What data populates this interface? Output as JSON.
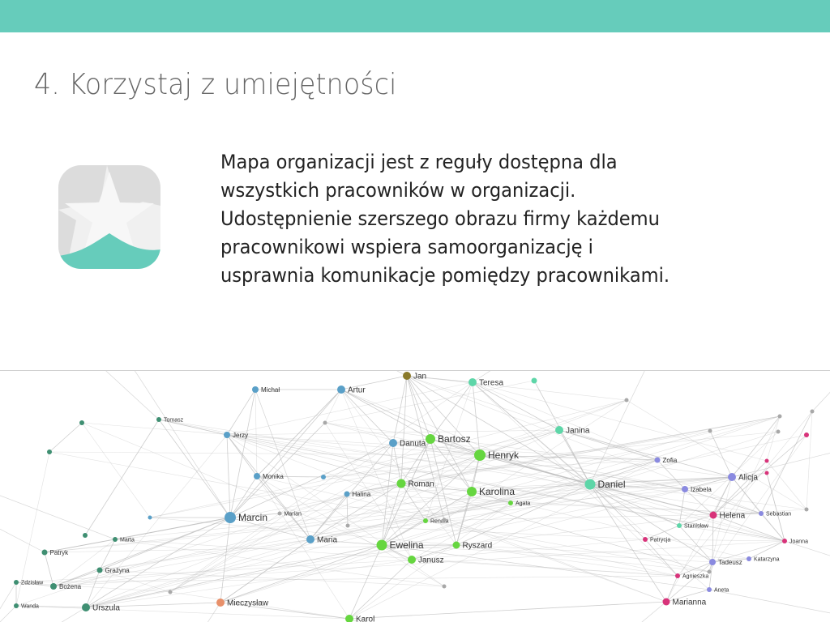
{
  "header": {
    "accent_color": "#66ccbb"
  },
  "title": "4. Korzystaj z umiejętności",
  "body_text": "Mapa organizacji jest z reguły dostępna dla\nwszystkich pracowników w organizacji.\nUdostępnienie szerszego obrazu firmy każdemu\npracownikowi wspiera samoorganizację i\nusprawnia komunikacje pomiędzy pracownikami.",
  "logo": {
    "icon": "star-icon",
    "colors": {
      "tile_light": "#f0f0f0",
      "tile_dark": "#dcdcdc",
      "accent": "#66ccbb"
    }
  },
  "network": {
    "edge_color": "#bdbdbd",
    "nodes": [
      {
        "id": "jan",
        "label": "Jan",
        "color": "#8a7a2a"
      },
      {
        "id": "teresa",
        "label": "Teresa",
        "color": "#5ed6a8"
      },
      {
        "id": "michal",
        "label": "Michał",
        "color": "#5aa0c8"
      },
      {
        "id": "artur",
        "label": "Artur",
        "color": "#5aa0c8"
      },
      {
        "id": "tomasz",
        "label": "Tomasz",
        "color": "#3f8f72"
      },
      {
        "id": "jerzy",
        "label": "Jerzy",
        "color": "#5aa0c8"
      },
      {
        "id": "danuta",
        "label": "Danuta",
        "color": "#5aa0c8"
      },
      {
        "id": "bartosz",
        "label": "Bartosz",
        "color": "#66d640"
      },
      {
        "id": "henryk",
        "label": "Henryk",
        "color": "#66d640"
      },
      {
        "id": "janina",
        "label": "Janina",
        "color": "#5ed6a8"
      },
      {
        "id": "zofia",
        "label": "Zofia",
        "color": "#8a8ae0"
      },
      {
        "id": "monika",
        "label": "Monika",
        "color": "#5aa0c8"
      },
      {
        "id": "roman",
        "label": "Roman",
        "color": "#66d640"
      },
      {
        "id": "karolina",
        "label": "Karolina",
        "color": "#66d640"
      },
      {
        "id": "daniel",
        "label": "Daniel",
        "color": "#5ed6a8"
      },
      {
        "id": "alicja",
        "label": "Alicja",
        "color": "#8a8ae0"
      },
      {
        "id": "izabela",
        "label": "Izabela",
        "color": "#8a8ae0"
      },
      {
        "id": "halina",
        "label": "Halina",
        "color": "#5aa0c8"
      },
      {
        "id": "agata",
        "label": "Agata",
        "color": "#66d640"
      },
      {
        "id": "marcin",
        "label": "Marcin",
        "color": "#5aa0c8"
      },
      {
        "id": "marian",
        "label": "Marian",
        "color": "#a8a8a8"
      },
      {
        "id": "renata",
        "label": "Renata",
        "color": "#66d640"
      },
      {
        "id": "helena",
        "label": "Helena",
        "color": "#d8337a"
      },
      {
        "id": "sebastian",
        "label": "Sebastian",
        "color": "#8a8ae0"
      },
      {
        "id": "stanislaw",
        "label": "Stanisław",
        "color": "#5ed6a8"
      },
      {
        "id": "maria",
        "label": "Maria",
        "color": "#5aa0c8"
      },
      {
        "id": "ewelina",
        "label": "Ewelina",
        "color": "#66d640"
      },
      {
        "id": "ryszard",
        "label": "Ryszard",
        "color": "#66d640"
      },
      {
        "id": "patrycja",
        "label": "Patrycja",
        "color": "#d8337a"
      },
      {
        "id": "joanna",
        "label": "Joanna",
        "color": "#d8337a"
      },
      {
        "id": "marta",
        "label": "Marta",
        "color": "#3f8f72"
      },
      {
        "id": "patryk",
        "label": "Patryk",
        "color": "#3f8f72"
      },
      {
        "id": "janusz",
        "label": "Janusz",
        "color": "#66d640"
      },
      {
        "id": "tadeusz",
        "label": "Tadeusz",
        "color": "#8a8ae0"
      },
      {
        "id": "katarzyna",
        "label": "Katarzyna",
        "color": "#8a8ae0"
      },
      {
        "id": "grazyna",
        "label": "Grażyna",
        "color": "#3f8f72"
      },
      {
        "id": "agnieszka",
        "label": "Agnieszka",
        "color": "#d8337a"
      },
      {
        "id": "zdzislaw",
        "label": "Zdzisław",
        "color": "#3f8f72"
      },
      {
        "id": "bozena",
        "label": "Bożena",
        "color": "#3f8f72"
      },
      {
        "id": "aneta",
        "label": "Aneta",
        "color": "#8a8ae0"
      },
      {
        "id": "mieczyslaw",
        "label": "Mieczysław",
        "color": "#e8906a"
      },
      {
        "id": "marianna",
        "label": "Marianna",
        "color": "#d8337a"
      },
      {
        "id": "wanda",
        "label": "Wanda",
        "color": "#3f8f72"
      },
      {
        "id": "urszula",
        "label": "Urszula",
        "color": "#3f8f72"
      },
      {
        "id": "karol",
        "label": "Karol",
        "color": "#66d640"
      },
      {
        "id": "u1",
        "label": "",
        "color": "#5ed6a8"
      },
      {
        "id": "u2",
        "label": "",
        "color": "#3f8f72"
      },
      {
        "id": "u3",
        "label": "",
        "color": "#3f8f72"
      },
      {
        "id": "u4",
        "label": "",
        "color": "#a8a8a8"
      },
      {
        "id": "u5",
        "label": "",
        "color": "#a8a8a8"
      },
      {
        "id": "u6",
        "label": "",
        "color": "#a8a8a8"
      },
      {
        "id": "u7",
        "label": "",
        "color": "#5aa0c8"
      },
      {
        "id": "u8",
        "label": "",
        "color": "#5aa0c8"
      },
      {
        "id": "u9",
        "label": "",
        "color": "#3f8f72"
      },
      {
        "id": "u10",
        "label": "",
        "color": "#a8a8a8"
      },
      {
        "id": "u11",
        "label": "",
        "color": "#a8a8a8"
      },
      {
        "id": "u12",
        "label": "",
        "color": "#d8337a"
      },
      {
        "id": "u13",
        "label": "",
        "color": "#d8337a"
      },
      {
        "id": "u14",
        "label": "",
        "color": "#a8a8a8"
      },
      {
        "id": "u15",
        "label": "",
        "color": "#a8a8a8"
      },
      {
        "id": "u16",
        "label": "",
        "color": "#a8a8a8"
      },
      {
        "id": "u17",
        "label": "",
        "color": "#a8a8a8"
      },
      {
        "id": "u18",
        "label": "",
        "color": "#d8337a"
      },
      {
        "id": "u19",
        "label": "",
        "color": "#a8a8a8"
      },
      {
        "id": "u20",
        "label": "",
        "color": "#a8a8a8"
      },
      {
        "id": "u21",
        "label": "",
        "color": "#a8a8a8"
      }
    ],
    "edges": [
      [
        "jan",
        "teresa"
      ],
      [
        "jan",
        "bartosz"
      ],
      [
        "jan",
        "danuta"
      ],
      [
        "jan",
        "henryk"
      ],
      [
        "jan",
        "artur"
      ],
      [
        "jan",
        "roman"
      ],
      [
        "jan",
        "daniel"
      ],
      [
        "jan",
        "karolina"
      ],
      [
        "teresa",
        "henryk"
      ],
      [
        "teresa",
        "bartosz"
      ],
      [
        "teresa",
        "daniel"
      ],
      [
        "teresa",
        "janina"
      ],
      [
        "michal",
        "artur"
      ],
      [
        "michal",
        "marcin"
      ],
      [
        "michal",
        "jerzy"
      ],
      [
        "artur",
        "danuta"
      ],
      [
        "artur",
        "bartosz"
      ],
      [
        "artur",
        "henryk"
      ],
      [
        "artur",
        "monika"
      ],
      [
        "artur",
        "marcin"
      ],
      [
        "tomasz",
        "marcin"
      ],
      [
        "tomasz",
        "jerzy"
      ],
      [
        "tomasz",
        "u9"
      ],
      [
        "jerzy",
        "marcin"
      ],
      [
        "jerzy",
        "monika"
      ],
      [
        "jerzy",
        "maria"
      ],
      [
        "danuta",
        "bartosz"
      ],
      [
        "danuta",
        "henryk"
      ],
      [
        "danuta",
        "roman"
      ],
      [
        "danuta",
        "marcin"
      ],
      [
        "danuta",
        "ewelina"
      ],
      [
        "danuta",
        "maria"
      ],
      [
        "bartosz",
        "henryk"
      ],
      [
        "bartosz",
        "karolina"
      ],
      [
        "bartosz",
        "roman"
      ],
      [
        "bartosz",
        "daniel"
      ],
      [
        "bartosz",
        "ewelina"
      ],
      [
        "bartosz",
        "ryszard"
      ],
      [
        "henryk",
        "karolina"
      ],
      [
        "henryk",
        "daniel"
      ],
      [
        "henryk",
        "roman"
      ],
      [
        "henryk",
        "ewelina"
      ],
      [
        "henryk",
        "janina"
      ],
      [
        "henryk",
        "izabela"
      ],
      [
        "henryk",
        "zofia"
      ],
      [
        "henryk",
        "helena"
      ],
      [
        "henryk",
        "ryszard"
      ],
      [
        "janina",
        "daniel"
      ],
      [
        "janina",
        "zofia"
      ],
      [
        "janina",
        "alicja"
      ],
      [
        "zofia",
        "izabela"
      ],
      [
        "zofia",
        "daniel"
      ],
      [
        "alicja",
        "izabela"
      ],
      [
        "alicja",
        "helena"
      ],
      [
        "alicja",
        "sebastian"
      ],
      [
        "alicja",
        "u19"
      ],
      [
        "monika",
        "marcin"
      ],
      [
        "monika",
        "maria"
      ],
      [
        "monika",
        "u7"
      ],
      [
        "roman",
        "karolina"
      ],
      [
        "roman",
        "ewelina"
      ],
      [
        "roman",
        "maria"
      ],
      [
        "roman",
        "renata"
      ],
      [
        "roman",
        "halina"
      ],
      [
        "karolina",
        "daniel"
      ],
      [
        "karolina",
        "ewelina"
      ],
      [
        "karolina",
        "ryszard"
      ],
      [
        "karolina",
        "agata"
      ],
      [
        "daniel",
        "izabela"
      ],
      [
        "daniel",
        "helena"
      ],
      [
        "daniel",
        "stanislaw"
      ],
      [
        "daniel",
        "tadeusz"
      ],
      [
        "daniel",
        "marianna"
      ],
      [
        "daniel",
        "patrycja"
      ],
      [
        "daniel",
        "alicja"
      ],
      [
        "izabela",
        "helena"
      ],
      [
        "izabela",
        "stanislaw"
      ],
      [
        "izabela",
        "sebastian"
      ],
      [
        "helena",
        "sebastian"
      ],
      [
        "helena",
        "stanislaw"
      ],
      [
        "helena",
        "tadeusz"
      ],
      [
        "helena",
        "joanna"
      ],
      [
        "helena",
        "u18"
      ],
      [
        "sebastian",
        "joanna"
      ],
      [
        "sebastian",
        "u20"
      ],
      [
        "stanislaw",
        "tadeusz"
      ],
      [
        "stanislaw",
        "patrycja"
      ],
      [
        "marcin",
        "maria"
      ],
      [
        "marcin",
        "marian"
      ],
      [
        "marcin",
        "marta"
      ],
      [
        "marcin",
        "patryk"
      ],
      [
        "marcin",
        "grazyna"
      ],
      [
        "marcin",
        "bozena"
      ],
      [
        "marcin",
        "urszula"
      ],
      [
        "marcin",
        "mieczyslaw"
      ],
      [
        "marcin",
        "u8"
      ],
      [
        "maria",
        "ewelina"
      ],
      [
        "maria",
        "mieczyslaw"
      ],
      [
        "maria",
        "halina"
      ],
      [
        "ewelina",
        "janusz"
      ],
      [
        "ewelina",
        "ryszard"
      ],
      [
        "ewelina",
        "karol"
      ],
      [
        "ewelina",
        "mieczyslaw"
      ],
      [
        "ewelina",
        "renata"
      ],
      [
        "ewelina",
        "urszula"
      ],
      [
        "ryszard",
        "janusz"
      ],
      [
        "ryszard",
        "daniel"
      ],
      [
        "tadeusz",
        "katarzyna"
      ],
      [
        "tadeusz",
        "aneta"
      ],
      [
        "tadeusz",
        "marianna"
      ],
      [
        "tadeusz",
        "agnieszka"
      ],
      [
        "patrycja",
        "agnieszka"
      ],
      [
        "katarzyna",
        "joanna"
      ],
      [
        "agnieszka",
        "marianna"
      ],
      [
        "aneta",
        "marianna"
      ],
      [
        "marta",
        "patryk"
      ],
      [
        "marta",
        "grazyna"
      ],
      [
        "patryk",
        "bozena"
      ],
      [
        "grazyna",
        "bozena"
      ],
      [
        "grazyna",
        "urszula"
      ],
      [
        "bozena",
        "zdzislaw"
      ],
      [
        "zdzislaw",
        "wanda"
      ],
      [
        "wanda",
        "urszula"
      ],
      [
        "urszula",
        "mieczyslaw"
      ],
      [
        "mieczyslaw",
        "karol"
      ],
      [
        "karol",
        "janusz"
      ],
      [
        "karol",
        "marianna"
      ],
      [
        "u1",
        "daniel"
      ],
      [
        "u2",
        "u3"
      ],
      [
        "u4",
        "marcin"
      ],
      [
        "u6",
        "alicja"
      ],
      [
        "u14",
        "tadeusz"
      ],
      [
        "u11",
        "halina"
      ],
      [
        "u10",
        "jan"
      ],
      [
        "u12",
        "helena"
      ],
      [
        "u13",
        "joanna"
      ]
    ]
  }
}
